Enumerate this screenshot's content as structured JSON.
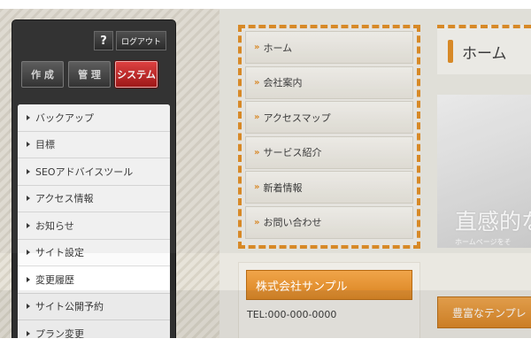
{
  "admin": {
    "help_label": "?",
    "logout_label": "ログアウト",
    "tabs": [
      {
        "label": "作 成",
        "active": false
      },
      {
        "label": "管 理",
        "active": false
      },
      {
        "label": "システム",
        "active": true
      }
    ],
    "menu": [
      "バックアップ",
      "目標",
      "SEOアドバイスツール",
      "アクセス情報",
      "お知らせ",
      "サイト設定",
      "変更履歴",
      "サイト公開予約",
      "プラン変更"
    ],
    "highlighted_item": "変更履歴"
  },
  "site_nav": {
    "items": [
      "ホーム",
      "会社案内",
      "アクセスマップ",
      "サービス紹介",
      "新着情報",
      "お問い合わせ"
    ]
  },
  "company": {
    "name": "株式会社サンプル",
    "tel": "TEL:000-000-0000"
  },
  "main": {
    "tab_label": "ホーム",
    "hero_title": "直感的な",
    "hero_sub": "ホームページをそ",
    "feature_button": "豊富なテンプレ"
  },
  "colors": {
    "accent_orange": "#e08a1e",
    "system_red": "#c01818",
    "panel_dark": "#2b2b2b"
  }
}
